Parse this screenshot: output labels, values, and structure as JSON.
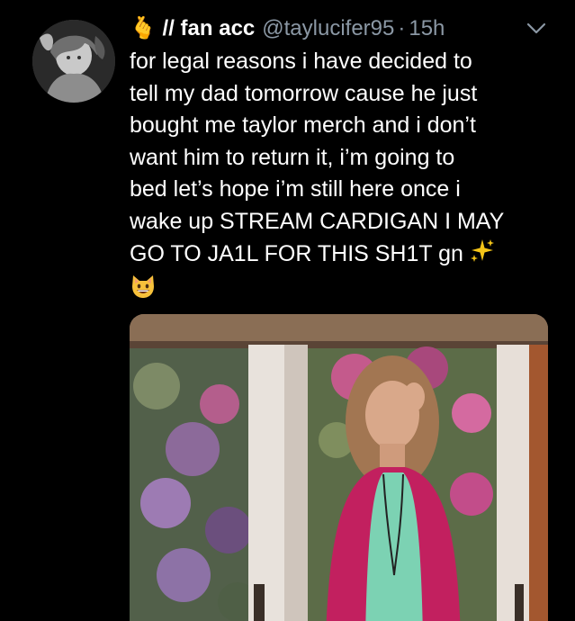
{
  "tweet": {
    "display_name": "🫰 // fan acc",
    "handle": "@taylucifer95",
    "separator": "·",
    "time": "15h",
    "text_lines": [
      "for legal reasons i have decided to",
      "tell my dad tomorrow cause he just",
      "bought me taylor merch and i don’t",
      "want him to return it, i’m going to",
      "bed let’s hope i’m still here once i",
      "wake up STREAM CARDIGAN I MAY",
      "GO TO JA1L FOR THIS SH1T gn"
    ],
    "icons": {
      "avatar": "profile-photo",
      "caret": "chevron-down-icon",
      "sparkles": "sparkles-emoji",
      "cat": "grinning-cat-emoji",
      "media": "video-thumbnail"
    }
  },
  "colors": {
    "background": "#000000",
    "text": "#ffffff",
    "secondary": "#8b98a5",
    "accent_pink": "#c2205f"
  }
}
